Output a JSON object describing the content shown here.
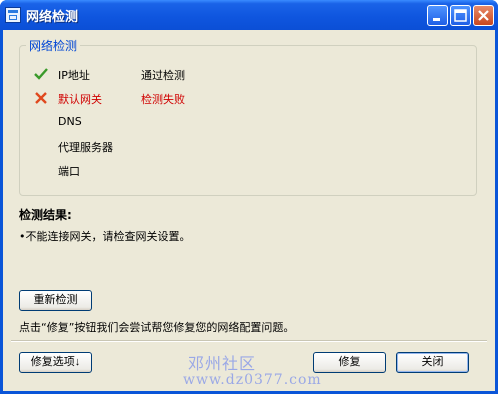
{
  "window": {
    "title": "网络检测"
  },
  "group": {
    "title": "网络检测",
    "rows": [
      {
        "label": "IP地址",
        "status": "通过检测",
        "result": "pass"
      },
      {
        "label": "默认网关",
        "status": "检测失败",
        "result": "fail"
      },
      {
        "label": "DNS",
        "status": "",
        "result": ""
      },
      {
        "label": "代理服务器",
        "status": "",
        "result": ""
      },
      {
        "label": "端口",
        "status": "",
        "result": ""
      }
    ]
  },
  "results": {
    "heading": "检测结果:",
    "text": "•不能连接网关，请检查网关设置。"
  },
  "buttons": {
    "retest": "重新检测",
    "repair_options": "修复选项↓",
    "repair": "修复",
    "close": "关闭"
  },
  "hint": "点击“修复”按钮我们会尝试帮您修复您的网络配置问题。",
  "watermark": {
    "line1": "邓州社区",
    "line2": "www.dz0377.com"
  },
  "colors": {
    "titlebar": "#0b4fd6",
    "client": "#ece9d8",
    "group_title": "#0046d5",
    "fail": "#d00000",
    "pass": "#3a9a2a"
  },
  "icons": {
    "pass": "check-icon",
    "fail": "x-icon"
  }
}
